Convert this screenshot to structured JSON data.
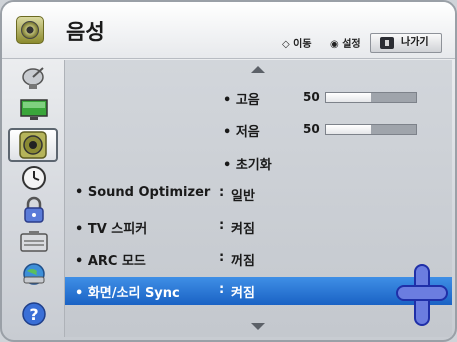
{
  "header": {
    "title": "음성",
    "hint_move": "◇ 이동",
    "hint_set": "◉ 설정",
    "exit_label": "나가기"
  },
  "sidebar": {
    "items": [
      {
        "icon": "satellite-dish-icon"
      },
      {
        "icon": "picture-icon"
      },
      {
        "icon": "speaker-icon",
        "active": true
      },
      {
        "icon": "clock-icon"
      },
      {
        "icon": "lock-icon"
      },
      {
        "icon": "options-icon"
      },
      {
        "icon": "network-globe-icon"
      },
      {
        "icon": "help-icon"
      }
    ]
  },
  "menu": {
    "treble": {
      "label": "• 고음",
      "value": "50",
      "level": 0.5
    },
    "bass": {
      "label": "• 저음",
      "value": "50",
      "level": 0.5
    },
    "reset": {
      "label": "• 초기화"
    },
    "rows": [
      {
        "label": "• Sound Optimizer",
        "colon": ":",
        "value": "일반"
      },
      {
        "label": "• TV 스피커",
        "colon": ":",
        "value": "켜짐"
      },
      {
        "label": "• ARC 모드",
        "colon": ":",
        "value": "꺼짐"
      },
      {
        "label": "• 화면/소리 Sync",
        "colon": ":",
        "value": "켜짐",
        "selected": true
      }
    ]
  },
  "colors": {
    "selection": "#1a62c4",
    "cursor": "#6b7de0"
  }
}
